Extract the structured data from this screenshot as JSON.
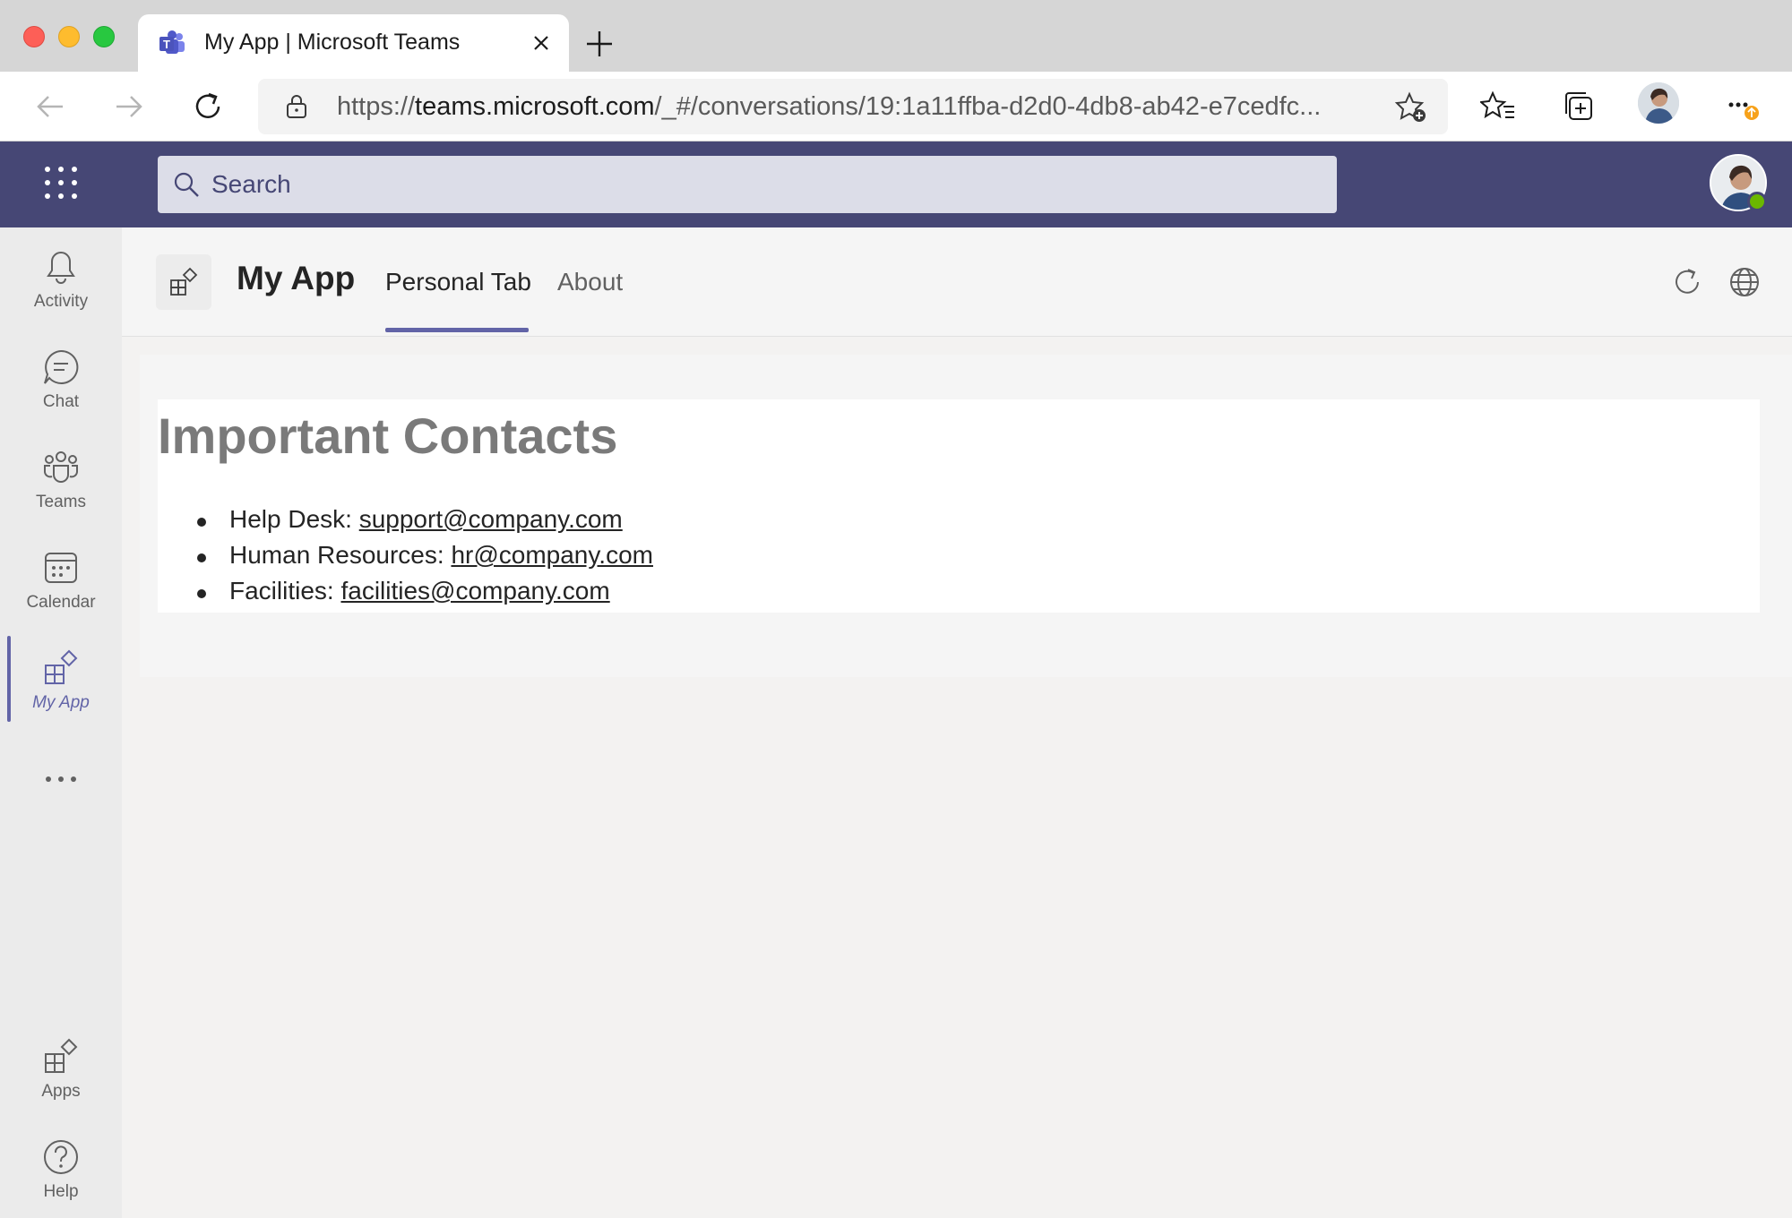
{
  "browser": {
    "tab_title": "My App | Microsoft Teams",
    "url_prefix": "https://",
    "url_domain": "teams.microsoft.com",
    "url_path": "/_#/conversations/19:1a11ffba-d2d0-4db8-ab42-e7cedfc..."
  },
  "teams": {
    "search_placeholder": "Search",
    "rail": [
      {
        "label": "Activity",
        "icon": "bell-icon"
      },
      {
        "label": "Chat",
        "icon": "chat-icon"
      },
      {
        "label": "Teams",
        "icon": "teams-icon"
      },
      {
        "label": "Calendar",
        "icon": "calendar-icon"
      },
      {
        "label": "My App",
        "icon": "app-icon",
        "active": true
      },
      {
        "label": "Apps",
        "icon": "apps-icon"
      },
      {
        "label": "Help",
        "icon": "help-icon"
      }
    ],
    "accent_color": "#6264a7",
    "header_color": "#464775"
  },
  "app": {
    "title": "My App",
    "tabs": [
      {
        "label": "Personal Tab",
        "active": true
      },
      {
        "label": "About",
        "active": false
      }
    ]
  },
  "content": {
    "heading": "Important Contacts",
    "contacts": [
      {
        "label": "Help Desk: ",
        "email": "support@company.com"
      },
      {
        "label": "Human Resources: ",
        "email": "hr@company.com"
      },
      {
        "label": "Facilities: ",
        "email": "facilities@company.com"
      }
    ]
  }
}
